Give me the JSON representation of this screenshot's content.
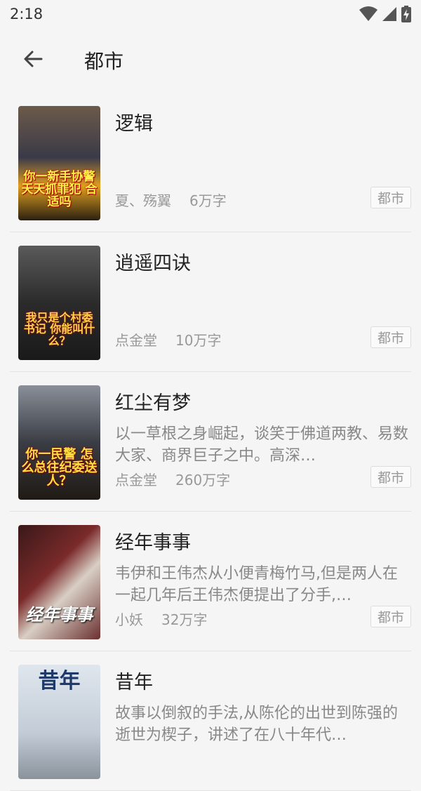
{
  "status_bar": {
    "time": "2:18"
  },
  "header": {
    "title": "都市"
  },
  "books": [
    {
      "title": "逻辑",
      "description": "",
      "author": "夏、殇翼",
      "word_count": "6万字",
      "tag": "都市",
      "cover_text": "你一新手协警 天天抓罪犯 合适吗"
    },
    {
      "title": "逍遥四诀",
      "description": "",
      "author": "点金堂",
      "word_count": "10万字",
      "tag": "都市",
      "cover_text": "我只是个村委书记 你能叫什么？"
    },
    {
      "title": "红尘有梦",
      "description": "以一草根之身崛起，谈笑于佛道两教、易数大家、商界巨子之中。高深…",
      "author": "点金堂",
      "word_count": "260万字",
      "tag": "都市",
      "cover_text": "你一民警 怎么总往纪委送人？"
    },
    {
      "title": "经年事事",
      "description": "韦伊和王伟杰从小便青梅竹马,但是两人在一起几年后王伟杰便提出了分手,…",
      "author": "小妖",
      "word_count": "32万字",
      "tag": "都市",
      "cover_text": "经年事事"
    },
    {
      "title": "昔年",
      "description": "故事以倒叙的手法,从陈伦的出世到陈强的逝世为楔子，讲述了在八十年代…",
      "author": "",
      "word_count": "",
      "tag": "",
      "cover_text": "昔年"
    }
  ],
  "colors": {
    "background": "#f5f5f5",
    "title_text": "#222222",
    "secondary_text": "#888888",
    "divider": "#e3e3e3"
  }
}
